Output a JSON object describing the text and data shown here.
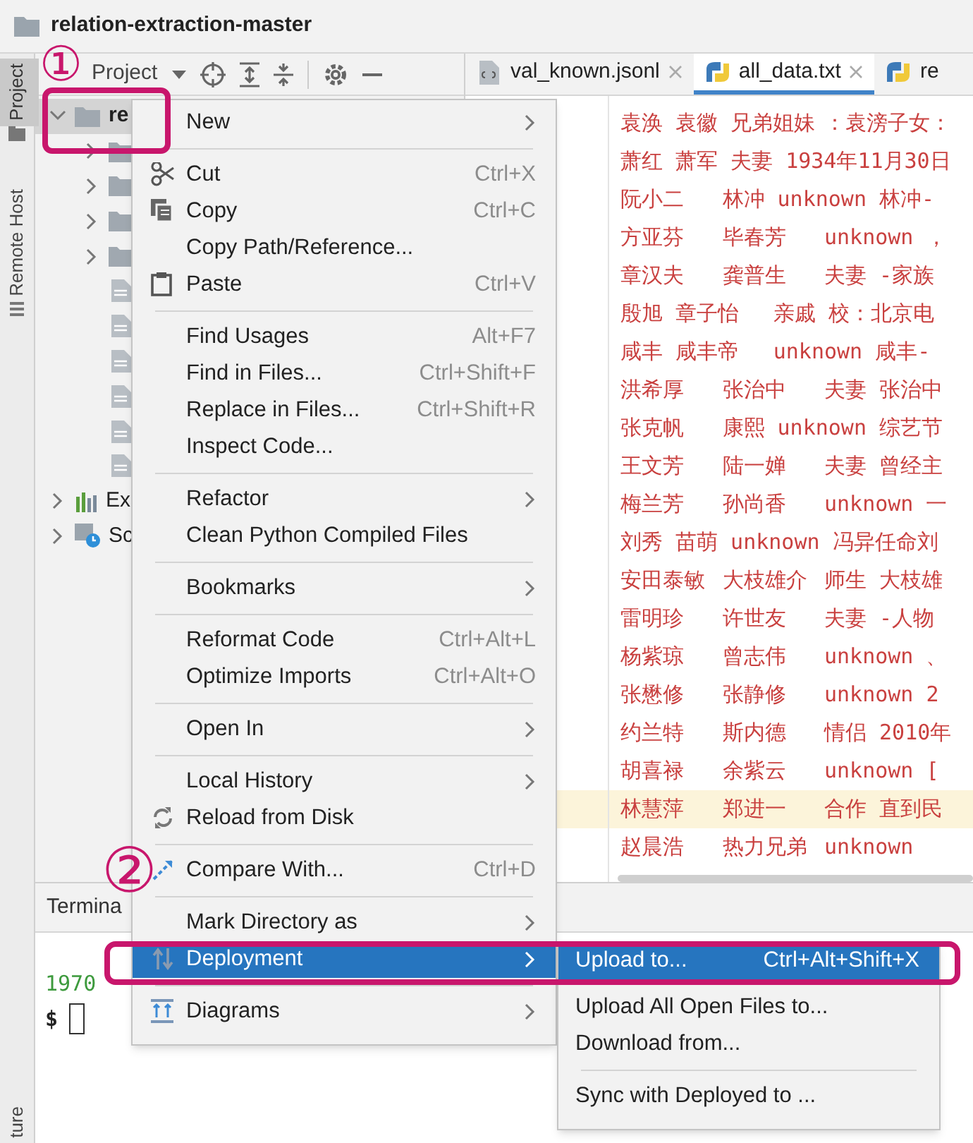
{
  "window": {
    "title": "relation-extraction-master"
  },
  "side_tabs": [
    {
      "label": "Project",
      "selected": true
    },
    {
      "label": "Remote Host",
      "selected": false
    },
    {
      "label": "ture",
      "selected": false
    }
  ],
  "project_panel": {
    "title": "Project"
  },
  "tree": [
    {
      "kind": "folder",
      "label": "re",
      "expanded": true,
      "selected": true,
      "children": [
        {
          "kind": "folder",
          "expanded": false,
          "selected": false
        },
        {
          "kind": "folder",
          "expanded": false,
          "selected": false
        },
        {
          "kind": "folder",
          "expanded": false,
          "selected": false
        },
        {
          "kind": "folder",
          "expanded": false,
          "selected": false
        },
        {
          "kind": "file",
          "selected": false
        },
        {
          "kind": "file",
          "selected": false
        },
        {
          "kind": "file",
          "selected": false
        },
        {
          "kind": "file",
          "selected": false
        },
        {
          "kind": "file",
          "selected": false
        },
        {
          "kind": "file",
          "selected": false
        }
      ]
    },
    {
      "kind": "library",
      "label": "Ex",
      "expanded": false,
      "selected": false
    },
    {
      "kind": "scratch",
      "label": "Sc",
      "expanded": false,
      "selected": false
    }
  ],
  "editor_tabs": [
    {
      "label": "val_known.jsonl",
      "selected": false,
      "closable": true
    },
    {
      "label": "all_data.txt",
      "selected": true,
      "closable": true
    },
    {
      "label": "re",
      "selected": false,
      "closable": false
    }
  ],
  "editor_lines": [
    {
      "text": "袁涣 袁徽 兄弟姐妹\t：袁滂子女：",
      "current": false
    },
    {
      "text": "萧红 萧军 夫妻 1934年11月30日",
      "current": false
    },
    {
      "text": "阮小二\t林冲 unknown 林冲-",
      "current": false
    },
    {
      "text": "方亚芬\t毕春芳\tunknown ，",
      "current": false
    },
    {
      "text": "章汉夫\t龚普生\t夫妻 -家族",
      "current": false
    },
    {
      "text": "殷旭 章子怡\t亲戚 校：北京电",
      "current": false
    },
    {
      "text": "咸丰 咸丰帝\tunknown 咸丰-",
      "current": false
    },
    {
      "text": "洪希厚\t张治中\t夫妻 张治中",
      "current": false
    },
    {
      "text": "张克帆\t康熙 unknown 综艺节",
      "current": false
    },
    {
      "text": "王文芳\t陆一婵\t夫妻 曾经主",
      "current": false
    },
    {
      "text": "梅兰芳\t孙尚香\tunknown 一",
      "current": false
    },
    {
      "text": "刘秀 苗萌 unknown 冯异任命刘",
      "current": false
    },
    {
      "text": "安田泰敏\t大枝雄介\t师生 大枝雄",
      "current": false
    },
    {
      "text": "雷明珍\t许世友\t夫妻 -人物",
      "current": false
    },
    {
      "text": "杨紫琼\t曾志伟\tunknown 、",
      "current": false
    },
    {
      "text": "张懋修\t张静修\tunknown 2",
      "current": false
    },
    {
      "text": "约兰特\t斯内德\t情侣 2010年",
      "current": false
    },
    {
      "text": "胡喜禄\t余紫云\tunknown [",
      "current": false
    },
    {
      "text": "林慧萍\t郑进一\t合作 直到民",
      "current": true
    },
    {
      "text": "赵晨浩\t热力兄弟\tunknown",
      "current": false
    }
  ],
  "terminal": {
    "tab": "Termina",
    "lines": [
      {
        "kind": "prompt_host",
        "text": "1970"
      },
      {
        "kind": "prompt",
        "text": "$"
      }
    ]
  },
  "context_menu": {
    "items": [
      {
        "kind": "item",
        "label": "New",
        "submenu": true,
        "selected": false
      },
      {
        "kind": "separator"
      },
      {
        "kind": "item",
        "label": "Cut",
        "shortcut": "Ctrl+X",
        "submenu": false,
        "selected": false
      },
      {
        "kind": "item",
        "label": "Copy",
        "shortcut": "Ctrl+C",
        "submenu": false,
        "selected": false
      },
      {
        "kind": "item",
        "label": "Copy Path/Reference...",
        "submenu": false,
        "selected": false
      },
      {
        "kind": "item",
        "label": "Paste",
        "shortcut": "Ctrl+V",
        "submenu": false,
        "selected": false
      },
      {
        "kind": "separator"
      },
      {
        "kind": "item",
        "label": "Find Usages",
        "shortcut": "Alt+F7",
        "submenu": false,
        "selected": false
      },
      {
        "kind": "item",
        "label": "Find in Files...",
        "shortcut": "Ctrl+Shift+F",
        "submenu": false,
        "selected": false
      },
      {
        "kind": "item",
        "label": "Replace in Files...",
        "shortcut": "Ctrl+Shift+R",
        "submenu": false,
        "selected": false
      },
      {
        "kind": "item",
        "label": "Inspect Code...",
        "submenu": false,
        "selected": false
      },
      {
        "kind": "separator"
      },
      {
        "kind": "item",
        "label": "Refactor",
        "submenu": true,
        "selected": false
      },
      {
        "kind": "item",
        "label": "Clean Python Compiled Files",
        "submenu": false,
        "selected": false
      },
      {
        "kind": "separator"
      },
      {
        "kind": "item",
        "label": "Bookmarks",
        "submenu": true,
        "selected": false
      },
      {
        "kind": "separator"
      },
      {
        "kind": "item",
        "label": "Reformat Code",
        "shortcut": "Ctrl+Alt+L",
        "submenu": false,
        "selected": false
      },
      {
        "kind": "item",
        "label": "Optimize Imports",
        "shortcut": "Ctrl+Alt+O",
        "submenu": false,
        "selected": false
      },
      {
        "kind": "separator"
      },
      {
        "kind": "item",
        "label": "Open In",
        "submenu": true,
        "selected": false
      },
      {
        "kind": "separator"
      },
      {
        "kind": "item",
        "label": "Local History",
        "submenu": true,
        "selected": false
      },
      {
        "kind": "item",
        "label": "Reload from Disk",
        "submenu": false,
        "selected": false
      },
      {
        "kind": "separator"
      },
      {
        "kind": "item",
        "label": "Compare With...",
        "shortcut": "Ctrl+D",
        "submenu": false,
        "selected": false
      },
      {
        "kind": "separator"
      },
      {
        "kind": "item",
        "label": "Mark Directory as",
        "submenu": true,
        "selected": false
      },
      {
        "kind": "item",
        "label": "Deployment",
        "submenu": true,
        "selected": true
      },
      {
        "kind": "separator"
      },
      {
        "kind": "item",
        "label": "Diagrams",
        "submenu": true,
        "selected": false
      }
    ]
  },
  "deployment_menu": {
    "items": [
      {
        "kind": "item",
        "label": "Upload to...",
        "shortcut": "Ctrl+Alt+Shift+X",
        "selected": true
      },
      {
        "kind": "item",
        "label": "Upload All Open Files to...",
        "selected": false
      },
      {
        "kind": "item",
        "label": "Download from...",
        "selected": false
      },
      {
        "kind": "separator"
      },
      {
        "kind": "item",
        "label": "Sync with Deployed to ...",
        "selected": false
      }
    ]
  },
  "annotations": [
    {
      "label": "①"
    },
    {
      "label": "②"
    }
  ]
}
